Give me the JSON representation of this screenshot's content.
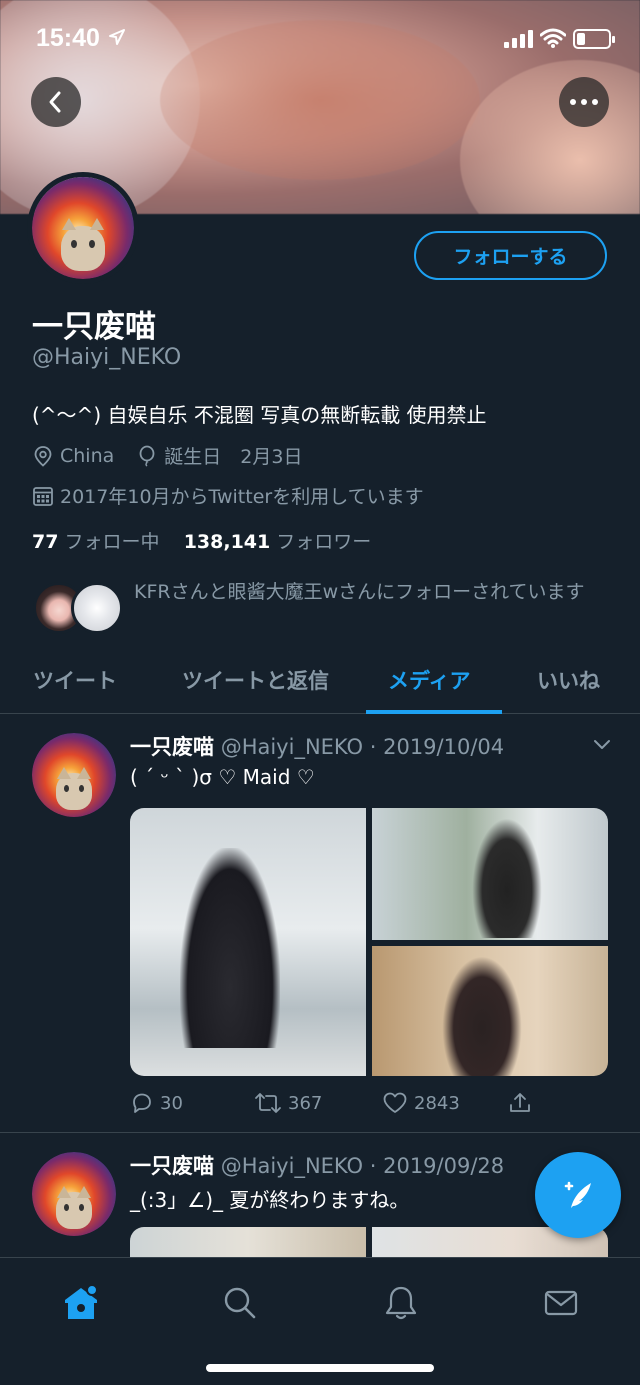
{
  "status_bar": {
    "time": "15:40",
    "battery_percent": 20
  },
  "profile": {
    "follow_label": "フォローする",
    "name": "一只废喵",
    "handle": "@Haiyi_NEKO",
    "bio": "(^〜^) 自娱自乐 不混圈 写真の無断転載 使用禁止",
    "location": "China",
    "birthday": "誕生日　2月3日",
    "joined": "2017年10月からTwitterを利用しています",
    "following_count": "77",
    "following_label": "フォロー中",
    "followers_count": "138,141",
    "followers_label": "フォロワー",
    "followed_by": "KFRさんと眼酱大魔王wさんにフォローされています"
  },
  "tabs": [
    {
      "label": "ツイート",
      "active": false
    },
    {
      "label": "ツイートと返信",
      "active": false
    },
    {
      "label": "メディア",
      "active": true
    },
    {
      "label": "いいね",
      "active": false
    }
  ],
  "tweets": [
    {
      "name": "一只废喵",
      "handle_date": "@Haiyi_NEKO · 2019/10/04",
      "text": "( ´ ᵕ ` )σ ♡ Maid ♡",
      "replies": "30",
      "retweets": "367",
      "likes": "2843"
    },
    {
      "name": "一只废喵",
      "handle_date": "@Haiyi_NEKO · 2019/09/28",
      "text": "_(:3」∠)_ 夏が終わりますね。"
    }
  ],
  "colors": {
    "background": "#15202b",
    "accent": "#1da1f2",
    "muted": "#8899a6",
    "divider": "#38444d"
  },
  "icons": [
    "back-arrow-icon",
    "more-icon",
    "location-icon",
    "birthday-balloon-icon",
    "calendar-icon",
    "reply-icon",
    "retweet-icon",
    "like-heart-icon",
    "share-icon",
    "compose-icon",
    "home-icon",
    "search-icon",
    "notifications-bell-icon",
    "messages-envelope-icon"
  ]
}
